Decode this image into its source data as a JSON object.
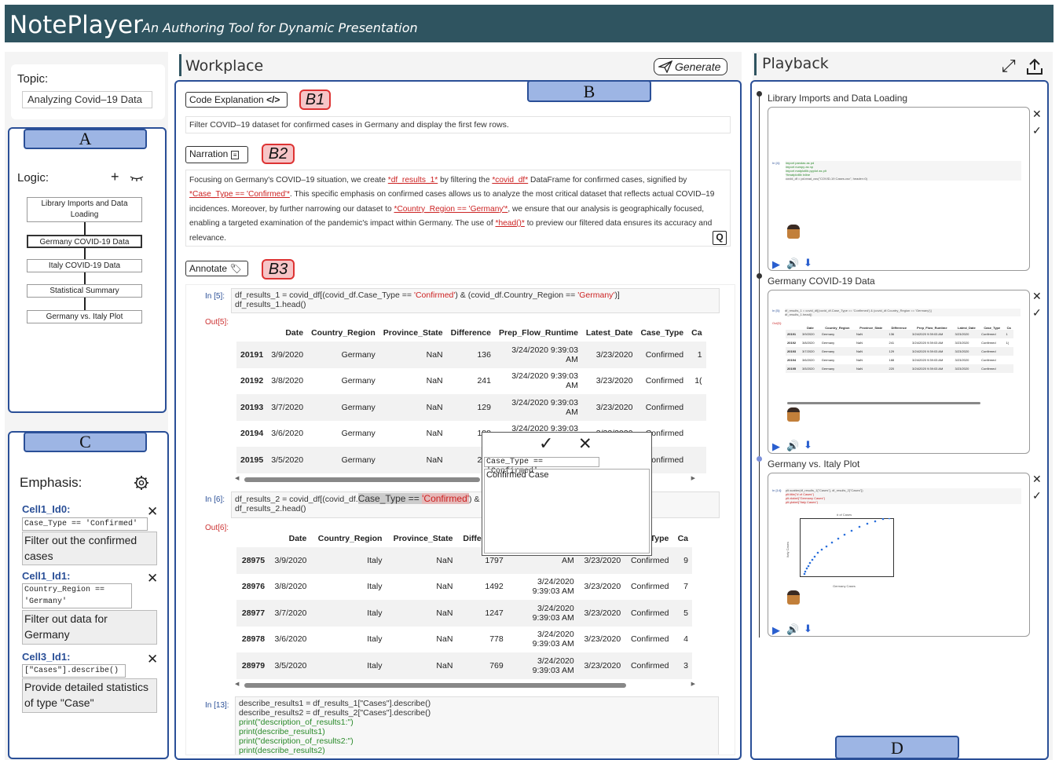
{
  "header": {
    "title": "NotePlayer",
    "subtitle": "An Authoring Tool for Dynamic Presentation"
  },
  "left": {
    "topic_label": "Topic:",
    "topic_value": "Analyzing Covid–19 Data",
    "panel_a_tag": "A",
    "logic_label": "Logic:",
    "add_symbol": "+",
    "nodes": [
      "Library Imports and Data Loading",
      "Germany COVID-19 Data",
      "Italy COVID-19 Data",
      "Statistical Summary",
      "Germany vs. Italy Plot"
    ],
    "panel_c_tag": "C",
    "emphasis_label": "Emphasis:",
    "cells": [
      {
        "name": "Cell1_Id0:",
        "code": "Case_Type == 'Confirmed'",
        "text": "Filter out the confirmed cases"
      },
      {
        "name": "Cell1_Id1:",
        "code": "Country_Region == 'Germany'",
        "text": "Filter out data for Germany"
      },
      {
        "name": "Cell3_Id1:",
        "code": "[\"Cases\"].describe()",
        "text": "Provide detailed statistics of type \"Case\""
      }
    ]
  },
  "workplace": {
    "title": "Workplace",
    "generate_label": "Generate",
    "panel_b_tag": "B",
    "code_explanation_label": "Code Explanation",
    "b1": "B1",
    "explanation_text": "Filter COVID–19 dataset for confirmed cases in Germany and display the first few rows.",
    "narration_label": "Narration",
    "b2": "B2",
    "narration_parts": [
      "Focusing on Germany's COVID–19 situation, we create ",
      "*df_results_1*",
      " by filtering the ",
      "*covid_df*",
      " DataFrame for confirmed cases, signified by ",
      "*Case_Type == 'Confirmed'*",
      ". This specific emphasis on confirmed cases allows us to analyze the most critical dataset that reflects actual COVID–19 incidences. Moreover, by further narrowing our dataset to ",
      "*Country_Region == 'Germany'*",
      ", we ensure that our analysis is geographically focused, enabling a targeted examination of the pandemic's impact within Germany. The use of ",
      "*head()*",
      " to preview our filtered data ensures its accuracy and relevance."
    ],
    "q_label": "Q",
    "annotate_label": "Annotate",
    "b3": "B3",
    "cell5": {
      "in_label": "In [5]:",
      "line1a": "df_results_1 = covid_df[(covid_df.Case_Type == ",
      "line1b": "'Confirmed'",
      "line1c": ") & (covid_df.Country_Region == ",
      "line1d": "'Germany'",
      "line1e": ")]",
      "line2": "df_results_1.head()",
      "out_label": "Out[5]:"
    },
    "columns": [
      "",
      "Date",
      "Country_Region",
      "Province_State",
      "Difference",
      "Prep_Flow_Runtime",
      "Latest_Date",
      "Case_Type",
      "Ca"
    ],
    "rows5": [
      [
        "20191",
        "3/9/2020",
        "Germany",
        "NaN",
        "136",
        "3/24/2020 9:39:03 AM",
        "3/23/2020",
        "Confirmed",
        "1"
      ],
      [
        "20192",
        "3/8/2020",
        "Germany",
        "NaN",
        "241",
        "3/24/2020 9:39:03 AM",
        "3/23/2020",
        "Confirmed",
        "1("
      ],
      [
        "20193",
        "3/7/2020",
        "Germany",
        "NaN",
        "129",
        "3/24/2020 9:39:03 AM",
        "3/23/2020",
        "Confirmed",
        ""
      ],
      [
        "20194",
        "3/6/2020",
        "Germany",
        "NaN",
        "188",
        "3/24/2020 9:39:03 AM",
        "3/23/2020",
        "Confirmed",
        ""
      ],
      [
        "20195",
        "3/5/2020",
        "Germany",
        "NaN",
        "220",
        "3/24/2020 9:39:03 AM",
        "3/23/2020",
        "Confirmed",
        ""
      ]
    ],
    "cell6": {
      "in_label": "In [6]:",
      "line1a": "df_results_2 = covid_df[(covid_df.",
      "line1b": "Case_Type",
      "line1c": " == ",
      "line1d": "'Confirmed'",
      "line1e": ") & (",
      "line2": "df_results_2.head()",
      "out_label": "Out[6]:"
    },
    "columns6": [
      "",
      "Date",
      "Country_Region",
      "Province_State",
      "Difference",
      "",
      "",
      "Type",
      "Ca"
    ],
    "rows6": [
      [
        "28975",
        "3/9/2020",
        "Italy",
        "NaN",
        "1797",
        "AM",
        "3/23/2020",
        "Confirmed",
        "9"
      ],
      [
        "28976",
        "3/8/2020",
        "Italy",
        "NaN",
        "1492",
        "3/24/2020 9:39:03 AM",
        "3/23/2020",
        "Confirmed",
        "7"
      ],
      [
        "28977",
        "3/7/2020",
        "Italy",
        "NaN",
        "1247",
        "3/24/2020 9:39:03 AM",
        "3/23/2020",
        "Confirmed",
        "5"
      ],
      [
        "28978",
        "3/6/2020",
        "Italy",
        "NaN",
        "778",
        "3/24/2020 9:39:03 AM",
        "3/23/2020",
        "Confirmed",
        "4"
      ],
      [
        "28979",
        "3/5/2020",
        "Italy",
        "NaN",
        "769",
        "3/24/2020 9:39:03 AM",
        "3/23/2020",
        "Confirmed",
        "3"
      ]
    ],
    "cell13": {
      "in_label": "In [13]:",
      "lines": [
        "describe_results1 = df_results_1[\"Cases\"].describe()",
        "describe_results2 = df_results_2[\"Cases\"].describe()",
        "print(\"description_of_results1:\")",
        "print(describe_results1)",
        "print(\"description_of_results2:\")",
        "print(describe_results2)"
      ]
    },
    "popup": {
      "code": "Case_Type == 'Confirmed'",
      "text": "Confirmed Case"
    }
  },
  "playback": {
    "title": "Playback",
    "panel_d_tag": "D",
    "slides": [
      {
        "title": "Library Imports and Data Loading",
        "code": [
          "In [4]:",
          "import pandas as pd",
          "import numpy as np",
          "import matplotlib.pyplot as plt",
          "%matplotlib inline",
          "covid_df = pd.read_csv(\"COVID-19 Cases.csv\", header=0)"
        ]
      },
      {
        "title": "Germany COVID-19 Data",
        "code": [
          "In [5]:",
          "df_results_1 = covid_df[(covid_df.Case_Type == 'Confirmed') & (covid_df.Country_Region == 'Germany')]",
          "df_results_1.head()",
          "Out[5]:"
        ]
      },
      {
        "title": "Germany vs. Italy Plot",
        "code": [
          "In [14]:",
          "plt.scatter(df_results_1[\"Cases\"], df_results_2[\"Cases\"])",
          "plt.title(\"# of Cases\")",
          "plt.xlabel(\"Germany Cases\")",
          "plt.ylabel(\"Italy Cases\")"
        ]
      }
    ],
    "mini_chart": {
      "title": "# of Cases",
      "xlabel": "Germany Cases",
      "ylabel": "Italy Cases",
      "xticks": [
        "0",
        "5000",
        "10000",
        "15000",
        "20000",
        "25000",
        "30000"
      ],
      "yticks": [
        "10000",
        "20000",
        "30000",
        "40000",
        "50000",
        "60000"
      ]
    }
  }
}
